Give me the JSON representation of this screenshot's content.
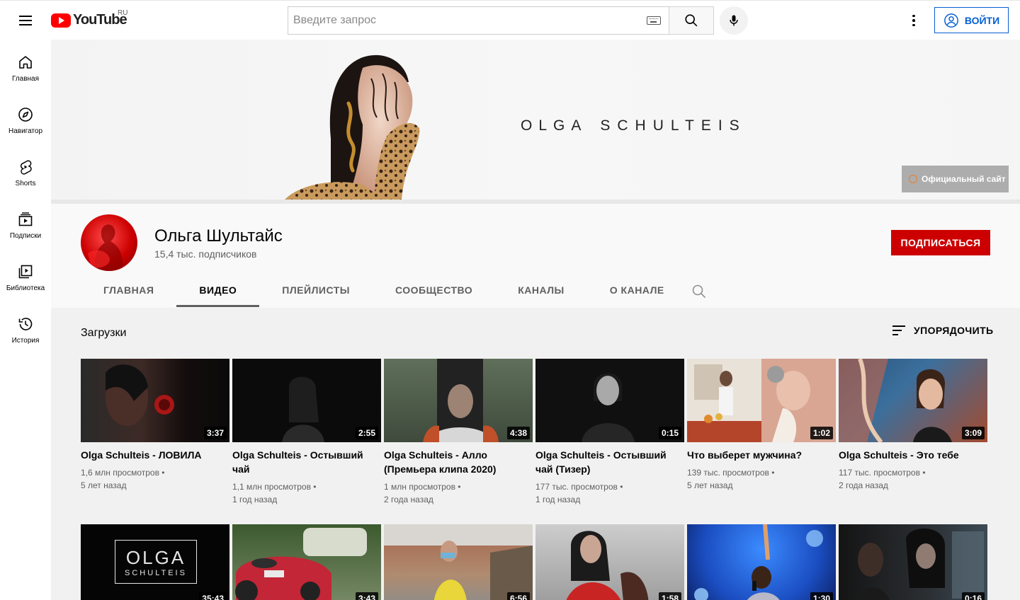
{
  "header": {
    "logo_text": "YouTube",
    "region": "RU",
    "search_placeholder": "Введите запрос",
    "signin_label": "ВОЙТИ"
  },
  "sidebar": {
    "items": [
      {
        "label": "Главная",
        "icon": "home-icon"
      },
      {
        "label": "Навигатор",
        "icon": "compass-icon"
      },
      {
        "label": "Shorts",
        "icon": "shorts-icon"
      },
      {
        "label": "Подписки",
        "icon": "subscriptions-icon"
      },
      {
        "label": "Библиотека",
        "icon": "library-icon"
      },
      {
        "label": "История",
        "icon": "history-icon"
      }
    ]
  },
  "banner": {
    "title_part1": "OLGA",
    "title_part2": "SCHULTEIS",
    "official_link": "Официальный сайт"
  },
  "channel": {
    "name": "Ольга Шультайс",
    "subscribers": "15,4 тыс. подписчиков",
    "subscribe_label": "ПОДПИСАТЬСЯ",
    "tabs": [
      "ГЛАВНАЯ",
      "ВИДЕО",
      "ПЛЕЙЛИСТЫ",
      "СООБЩЕСТВО",
      "КАНАЛЫ",
      "О КАНАЛЕ"
    ],
    "active_tab": "ВИДЕО"
  },
  "content": {
    "section_title": "Загрузки",
    "sort_label": "УПОРЯДОЧИТЬ",
    "videos": [
      {
        "title": "Olga Schulteis - ЛОВИЛА",
        "views": "1,6 млн просмотров",
        "age": "5 лет назад",
        "duration": "3:37"
      },
      {
        "title": "Olga Schulteis - Остывший чай",
        "views": "1,1 млн просмотров",
        "age": "1 год назад",
        "duration": "2:55"
      },
      {
        "title": "Olga Schulteis - Алло (Премьера клипа 2020)",
        "views": "1 млн просмотров",
        "age": "2 года назад",
        "duration": "4:38"
      },
      {
        "title": "Olga Schulteis - Остывший чай (Тизер)",
        "views": "177 тыс. просмотров",
        "age": "1 год назад",
        "duration": "0:15"
      },
      {
        "title": "Что выберет мужчина?",
        "views": "139 тыс. просмотров",
        "age": "5 лет назад",
        "duration": "1:02"
      },
      {
        "title": "Olga Schulteis - Это тебе",
        "views": "117 тыс. просмотров",
        "age": "2 года назад",
        "duration": "3:09"
      },
      {
        "title": "",
        "views": "",
        "age": "",
        "duration": "35:43",
        "thumb_text_1": "OLGA",
        "thumb_text_2": "SCHULTEIS"
      },
      {
        "title": "",
        "views": "",
        "age": "",
        "duration": "3:43"
      },
      {
        "title": "",
        "views": "",
        "age": "",
        "duration": "6:56"
      },
      {
        "title": "",
        "views": "",
        "age": "",
        "duration": "1:58"
      },
      {
        "title": "",
        "views": "",
        "age": "",
        "duration": "1:30"
      },
      {
        "title": "",
        "views": "",
        "age": "",
        "duration": "0:16"
      }
    ]
  },
  "colors": {
    "brand_red": "#ff0000",
    "subscribe_red": "#cc0000",
    "link_blue": "#065fd4"
  }
}
